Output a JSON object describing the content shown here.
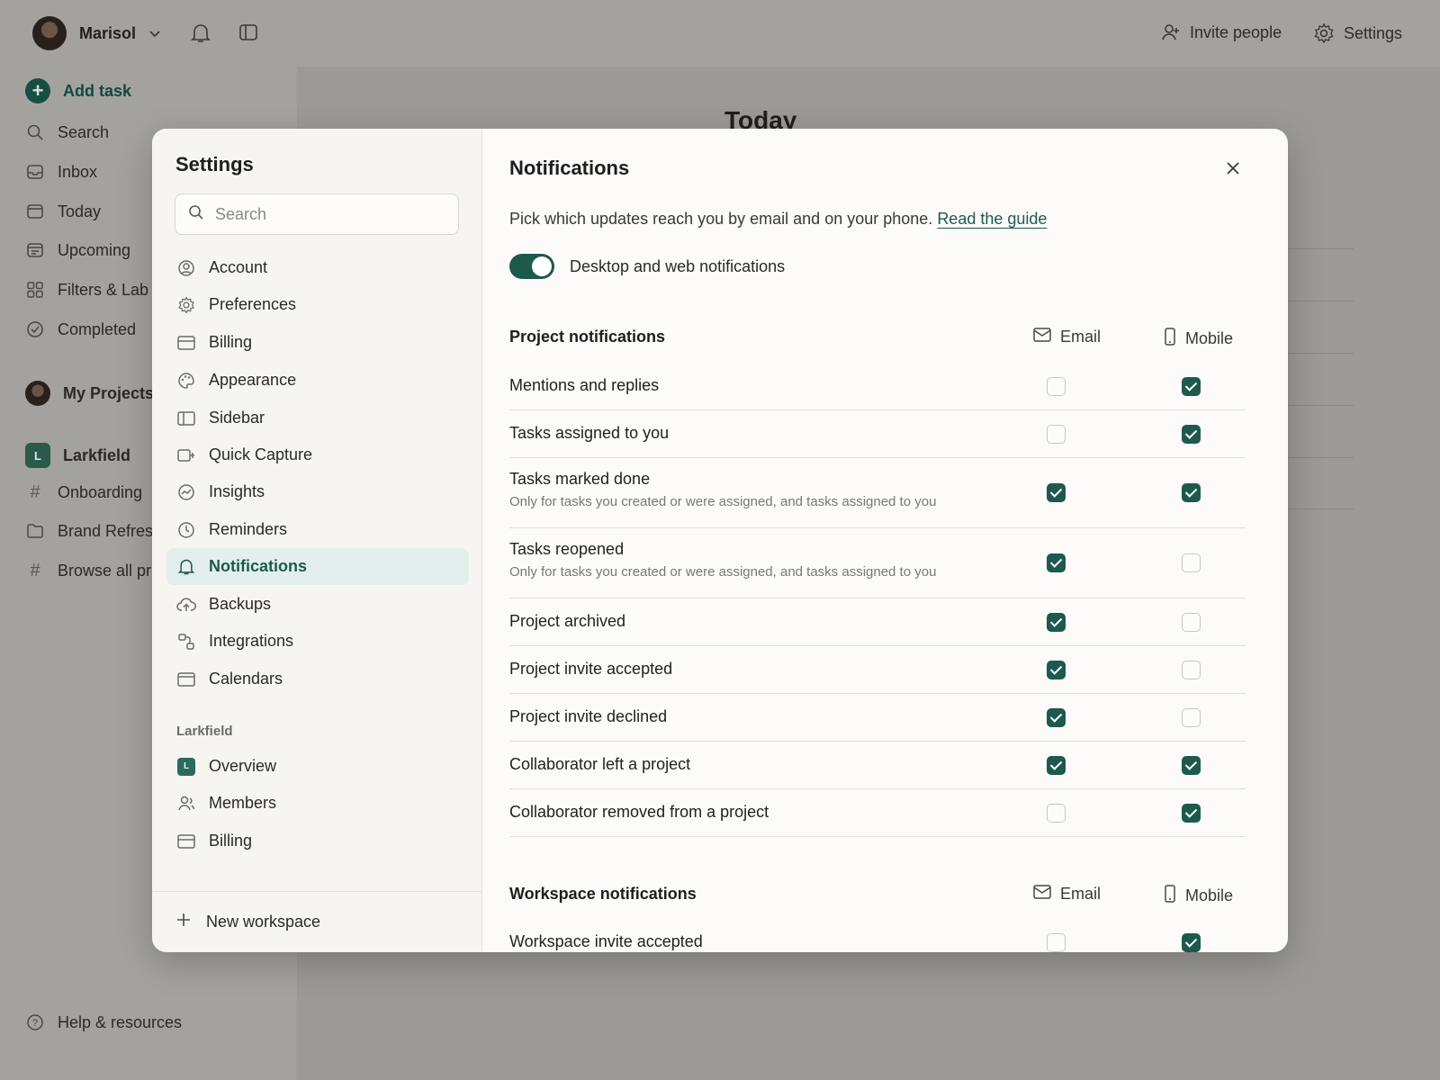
{
  "app": {
    "user_name": "Marisol",
    "top_right": {
      "invite_label": "Invite people",
      "settings_label": "Settings"
    },
    "sidebar": {
      "add_task": "Add task",
      "items": [
        {
          "label": "Search",
          "icon": "search-icon"
        },
        {
          "label": "Inbox",
          "icon": "inbox-icon"
        },
        {
          "label": "Today",
          "icon": "calendar-icon"
        },
        {
          "label": "Upcoming",
          "icon": "calendar-grid-icon"
        },
        {
          "label": "Filters & Lab",
          "icon": "grid-icon"
        },
        {
          "label": "Completed",
          "icon": "check-circle-icon"
        }
      ],
      "my_projects": "My Projects",
      "workspace": {
        "badge": "L",
        "name": "Larkfield"
      },
      "projects": [
        {
          "label": "Onboarding",
          "icon": "hash-icon"
        },
        {
          "label": "Brand Refres",
          "icon": "folder-icon"
        },
        {
          "label": "Browse all pr",
          "icon": "hash-icon"
        }
      ],
      "help": "Help & resources"
    },
    "main_title": "Today"
  },
  "settings": {
    "title": "Settings",
    "search_placeholder": "Search",
    "menu": [
      {
        "label": "Account",
        "icon": "user-circle-icon"
      },
      {
        "label": "Preferences",
        "icon": "gear-icon"
      },
      {
        "label": "Billing",
        "icon": "credit-card-icon"
      },
      {
        "label": "Appearance",
        "icon": "palette-icon"
      },
      {
        "label": "Sidebar",
        "icon": "sidebar-icon"
      },
      {
        "label": "Quick Capture",
        "icon": "quick-capture-icon"
      },
      {
        "label": "Insights",
        "icon": "insights-icon"
      },
      {
        "label": "Reminders",
        "icon": "clock-icon"
      },
      {
        "label": "Notifications",
        "icon": "bell-icon",
        "active": true
      },
      {
        "label": "Backups",
        "icon": "cloud-upload-icon"
      },
      {
        "label": "Integrations",
        "icon": "integrations-icon"
      },
      {
        "label": "Calendars",
        "icon": "calendar-icon"
      }
    ],
    "workspace_section": "Larkfield",
    "workspace_badge": "L",
    "workspace_menu": [
      {
        "label": "Overview",
        "icon": "workspace-badge-icon"
      },
      {
        "label": "Members",
        "icon": "members-icon"
      },
      {
        "label": "Billing",
        "icon": "credit-card-icon"
      }
    ],
    "new_workspace": "New workspace"
  },
  "notifications": {
    "title": "Notifications",
    "intro_text": "Pick which updates reach you by email and on your phone.",
    "intro_link": "Read the guide",
    "desktop_toggle": {
      "label": "Desktop and web notifications",
      "on": true
    },
    "columns": {
      "email": "Email",
      "mobile": "Mobile"
    },
    "project_section": "Project notifications",
    "project_rows": [
      {
        "label": "Mentions and replies",
        "email": false,
        "mobile": true
      },
      {
        "label": "Tasks assigned to you",
        "email": false,
        "mobile": true
      },
      {
        "label": "Tasks marked done",
        "sub": "Only for tasks you created or were assigned, and tasks assigned to you",
        "email": true,
        "mobile": true
      },
      {
        "label": "Tasks reopened",
        "sub": "Only for tasks you created or were assigned, and tasks assigned to you",
        "email": true,
        "mobile": false
      },
      {
        "label": "Project archived",
        "email": true,
        "mobile": false
      },
      {
        "label": "Project invite accepted",
        "email": true,
        "mobile": false
      },
      {
        "label": "Project invite declined",
        "email": true,
        "mobile": false
      },
      {
        "label": "Collaborator left a project",
        "email": true,
        "mobile": true
      },
      {
        "label": "Collaborator removed from a project",
        "email": false,
        "mobile": true
      }
    ],
    "workspace_section": "Workspace notifications",
    "workspace_rows": [
      {
        "label": "Workspace invite accepted",
        "email": false,
        "mobile": true
      }
    ]
  },
  "colors": {
    "accent": "#1d5a4d",
    "active_bg": "#e3efec",
    "overlay": "#a4a29e"
  }
}
